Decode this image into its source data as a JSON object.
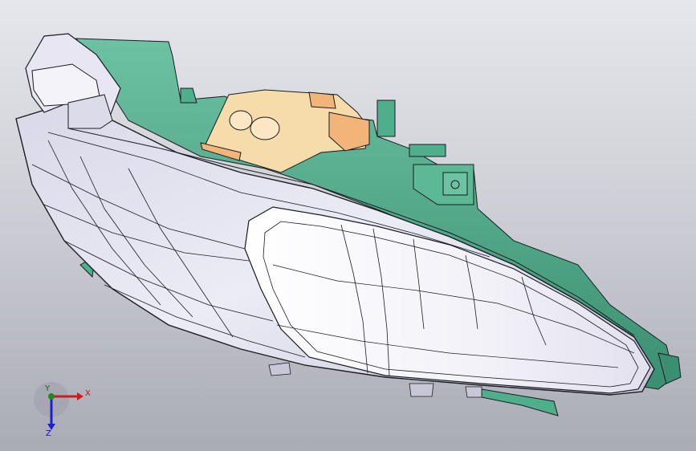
{
  "viewport": {
    "background_top": "#e6e7ec",
    "background_bottom": "#a9abb5"
  },
  "model": {
    "body_color": "#e9e9f3",
    "shadow_color": "#c9c9d9",
    "highlight_color": "#f5f4fa",
    "bracket_color": "#4fae8c",
    "bracket_dark": "#2f7f63",
    "housing_color": "#f5d9a8",
    "housing_accent": "#f0b072",
    "edge_color": "#1b1b22"
  },
  "triad": {
    "x_label": "X",
    "y_label": "Y",
    "z_label": "Z",
    "x_color": "#d11a1a",
    "y_color": "#1f8a1f",
    "z_color": "#1f1fd1"
  }
}
